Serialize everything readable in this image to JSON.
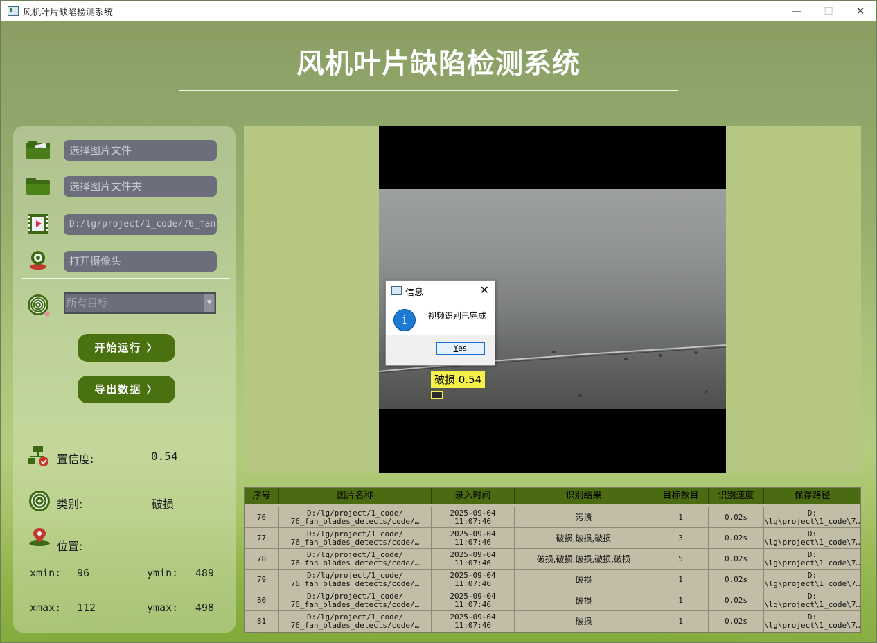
{
  "window": {
    "title": "风机叶片缺陷检测系统",
    "min": "—",
    "max": "☐",
    "close": "✕"
  },
  "header": {
    "title": "风机叶片缺陷检测系统"
  },
  "sidebar": {
    "image_file_placeholder": "选择图片文件",
    "image_folder_placeholder": "选择图片文件夹",
    "video_path": "D:/lg/project/1_code/76_fan",
    "camera_placeholder": "打开摄像头",
    "target_select": "所有目标",
    "start_button": "开始运行 〉",
    "export_button": "导出数据 〉"
  },
  "stats": {
    "confidence_label": "置信度:",
    "confidence_value": "0.54",
    "class_label": "类别:",
    "class_value": "破损",
    "position_label": "位置:",
    "xmin_label": "xmin:",
    "xmin_value": "96",
    "ymin_label": "ymin:",
    "ymin_value": "489",
    "xmax_label": "xmax:",
    "xmax_value": "112",
    "ymax_label": "ymax:",
    "ymax_value": "498"
  },
  "detection": {
    "label": "破损 0.54"
  },
  "dialog": {
    "title": "信息",
    "message": "视频识别已完成",
    "yes_prefix": "Y",
    "yes_rest": "es",
    "info_glyph": "i",
    "close": "✕"
  },
  "table": {
    "headers": [
      "序号",
      "图片名称",
      "录入时间",
      "识别结果",
      "目标数目",
      "识别速度",
      "保存路径"
    ],
    "rows": [
      [
        "76",
        "D:/lg/project/1_code/\n76_fan_blades_detects/code/…",
        "2025-09-04\n11:07:46",
        "污渍",
        "1",
        "0.02s",
        "D:\n\\lg\\project\\1_code\\7…"
      ],
      [
        "77",
        "D:/lg/project/1_code/\n76_fan_blades_detects/code/…",
        "2025-09-04\n11:07:46",
        "破损,破损,破损",
        "3",
        "0.02s",
        "D:\n\\lg\\project\\1_code\\7…"
      ],
      [
        "78",
        "D:/lg/project/1_code/\n76_fan_blades_detects/code/…",
        "2025-09-04\n11:07:46",
        "破损,破损,破损,破损,破损",
        "5",
        "0.02s",
        "D:\n\\lg\\project\\1_code\\7…"
      ],
      [
        "79",
        "D:/lg/project/1_code/\n76_fan_blades_detects/code/…",
        "2025-09-04\n11:07:46",
        "破损",
        "1",
        "0.02s",
        "D:\n\\lg\\project\\1_code\\7…"
      ],
      [
        "80",
        "D:/lg/project/1_code/\n76_fan_blades_detects/code/…",
        "2025-09-04\n11:07:46",
        "破损",
        "1",
        "0.02s",
        "D:\n\\lg\\project\\1_code\\7…"
      ],
      [
        "81",
        "D:/lg/project/1_code/\n76_fan_blades_detects/code/…",
        "2025-09-04\n11:07:46",
        "破损",
        "1",
        "0.02s",
        "D:\n\\lg\\project\\1_code\\7…"
      ]
    ]
  }
}
